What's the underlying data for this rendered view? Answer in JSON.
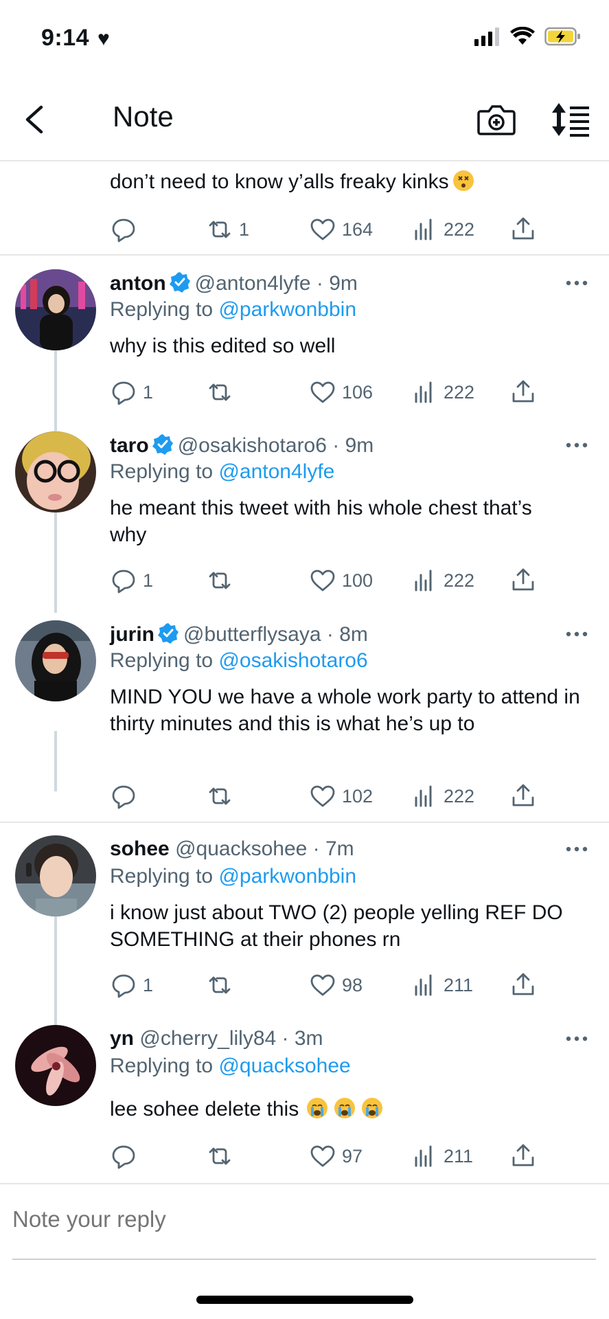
{
  "status": {
    "time": "9:14",
    "heart": "♥"
  },
  "nav": {
    "title": "Note"
  },
  "partial": {
    "text": "don’t need to know y’alls freaky kinks",
    "retweets": "1",
    "likes": "164",
    "views": "222"
  },
  "tweets": [
    {
      "name": "anton",
      "handle": "@anton4lyfe · 9m",
      "verified": true,
      "reply_prefix": "Replying to ",
      "reply_to": "@parkwonbbin",
      "text": "why is this edited so well",
      "replies": "1",
      "retweets": "",
      "likes": "106",
      "views": "222"
    },
    {
      "name": "taro",
      "handle": "@osakishotaro6 · 9m",
      "verified": true,
      "reply_prefix": "Replying to ",
      "reply_to": "@anton4lyfe",
      "text": "he meant this tweet with his whole chest that’s why",
      "replies": "1",
      "retweets": "",
      "likes": "100",
      "views": "222"
    },
    {
      "name": "jurin",
      "handle": "@butterflysaya · 8m",
      "verified": true,
      "reply_prefix": "Replying to ",
      "reply_to": "@osakishotaro6",
      "text": "MIND YOU we have a whole work party to attend in thirty minutes and this is what he’s up to",
      "replies": "",
      "retweets": "",
      "likes": "102",
      "views": "222"
    },
    {
      "name": "sohee",
      "handle": "@quacksohee · 7m",
      "verified": false,
      "reply_prefix": "Replying to ",
      "reply_to": "@parkwonbbin",
      "text": "i know just about TWO (2) people yelling REF DO SOMETHING at their phones rn",
      "replies": "1",
      "retweets": "",
      "likes": "98",
      "views": "211"
    },
    {
      "name": "yn",
      "handle": "@cherry_lily84 · 3m",
      "verified": false,
      "reply_prefix": "Replying to ",
      "reply_to": "@quacksohee",
      "text": "lee sohee delete this",
      "replies": "",
      "retweets": "",
      "likes": "97",
      "views": "211"
    }
  ],
  "reply_box": {
    "placeholder": "Note your reply"
  },
  "colors": {
    "accent": "#1d9bf0",
    "muted": "#536471",
    "text": "#0f1419",
    "divider": "#e6e6e6"
  },
  "icons": [
    "back-icon",
    "camera-icon",
    "sort-icon",
    "reply-icon",
    "retweet-icon",
    "like-icon",
    "views-icon",
    "share-icon",
    "verified-icon",
    "more-icon"
  ]
}
